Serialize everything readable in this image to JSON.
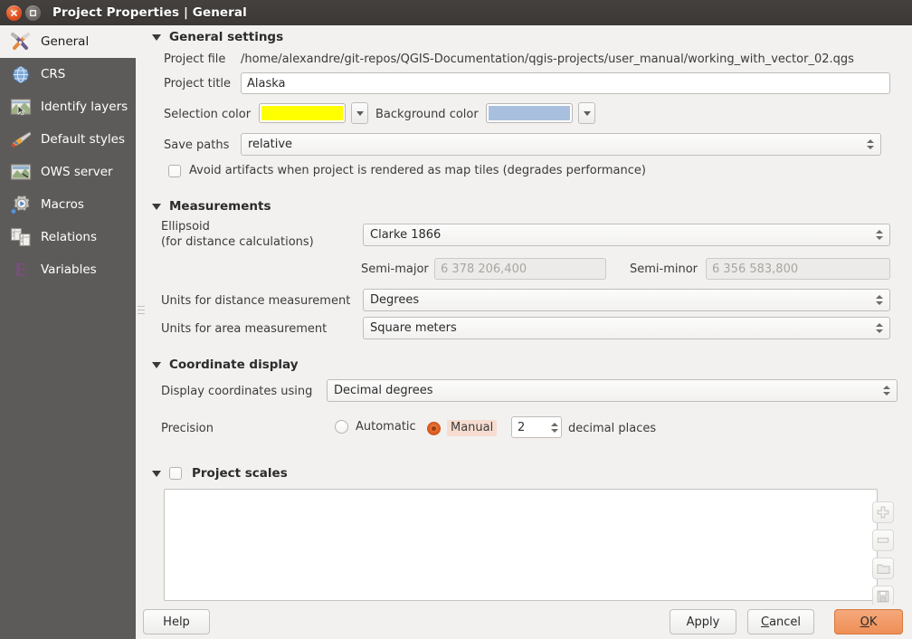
{
  "window": {
    "title": "Project Properties | General",
    "close_icon": "close-icon",
    "maximize_icon": "maximize-icon"
  },
  "sidebar": {
    "items": [
      {
        "label": "General",
        "icon": "hammer-wrench-icon",
        "selected": true
      },
      {
        "label": "CRS",
        "icon": "globe-icon",
        "selected": false
      },
      {
        "label": "Identify layers",
        "icon": "map-cursor-icon",
        "selected": false
      },
      {
        "label": "Default styles",
        "icon": "paintbrush-icon",
        "selected": false
      },
      {
        "label": "OWS server",
        "icon": "ows-map-icon",
        "selected": false
      },
      {
        "label": "Macros",
        "icon": "gear-play-icon",
        "selected": false
      },
      {
        "label": "Relations",
        "icon": "tables-relation-icon",
        "selected": false
      },
      {
        "label": "Variables",
        "icon": "epsilon-icon",
        "selected": false
      }
    ]
  },
  "general_settings": {
    "heading": "General settings",
    "project_file_label": "Project file",
    "project_file_value": "/home/alexandre/git-repos/QGIS-Documentation/qgis-projects/user_manual/working_with_vector_02.qgs",
    "project_title_label": "Project title",
    "project_title_value": "Alaska",
    "selection_color_label": "Selection color",
    "selection_color_value": "#ffff00",
    "background_color_label": "Background color",
    "background_color_value": "#a8c0dd",
    "save_paths_label": "Save paths",
    "save_paths_value": "relative",
    "avoid_artifacts_label": "Avoid artifacts when project is rendered as map tiles (degrades performance)",
    "avoid_artifacts_checked": false
  },
  "measurements": {
    "heading": "Measurements",
    "ellipsoid_label_line1": "Ellipsoid",
    "ellipsoid_label_line2": "(for distance calculations)",
    "ellipsoid_value": "Clarke 1866",
    "semi_major_label": "Semi-major",
    "semi_major_value": "6 378 206,400",
    "semi_minor_label": "Semi-minor",
    "semi_minor_value": "6 356 583,800",
    "distance_units_label": "Units for distance measurement",
    "distance_units_value": "Degrees",
    "area_units_label": "Units for area measurement",
    "area_units_value": "Square meters"
  },
  "coordinate_display": {
    "heading": "Coordinate display",
    "display_using_label": "Display coordinates using",
    "display_using_value": "Decimal degrees",
    "precision_label": "Precision",
    "automatic_label": "Automatic",
    "manual_label": "Manual",
    "selected_mode": "Manual",
    "decimal_value": "2",
    "decimal_places_label": "decimal places"
  },
  "project_scales": {
    "heading": "Project scales",
    "checked": false,
    "scales": [],
    "buttons": [
      {
        "name": "add-scale-button",
        "icon": "plus-icon"
      },
      {
        "name": "remove-scale-button",
        "icon": "minus-icon"
      },
      {
        "name": "open-scales-button",
        "icon": "folder-icon"
      },
      {
        "name": "save-scales-button",
        "icon": "save-icon"
      }
    ]
  },
  "buttons": {
    "help": "Help",
    "apply": "Apply",
    "cancel_pre": "",
    "cancel_mn": "C",
    "cancel_post": "ancel",
    "ok_mn": "O",
    "ok_post": "K"
  },
  "colors": {
    "titlebar": "#3c3835",
    "sidebar": "#5d5b59",
    "content": "#f2f1f0",
    "accent": "#ef8f56",
    "radio_accent": "#e2642a"
  }
}
